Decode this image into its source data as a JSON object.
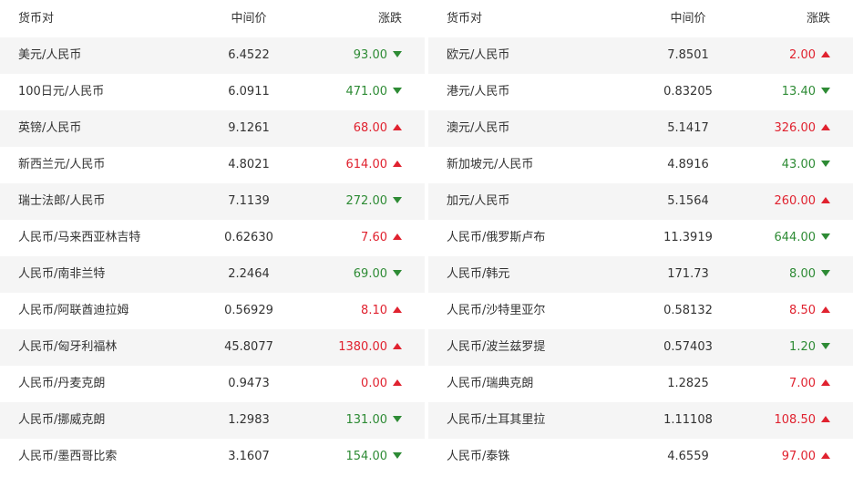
{
  "headers": {
    "pair": "货币对",
    "mid": "中间价",
    "change": "涨跌"
  },
  "colors": {
    "up": "#e0222f",
    "down": "#2e8b35",
    "stripe": "#f5f5f5"
  },
  "left": [
    {
      "pair": "美元/人民币",
      "mid": "6.4522",
      "change": "93.00",
      "dir": "down"
    },
    {
      "pair": "100日元/人民币",
      "mid": "6.0911",
      "change": "471.00",
      "dir": "down"
    },
    {
      "pair": "英镑/人民币",
      "mid": "9.1261",
      "change": "68.00",
      "dir": "up"
    },
    {
      "pair": "新西兰元/人民币",
      "mid": "4.8021",
      "change": "614.00",
      "dir": "up"
    },
    {
      "pair": "瑞士法郎/人民币",
      "mid": "7.1139",
      "change": "272.00",
      "dir": "down"
    },
    {
      "pair": "人民币/马来西亚林吉特",
      "mid": "0.62630",
      "change": "7.60",
      "dir": "up"
    },
    {
      "pair": "人民币/南非兰特",
      "mid": "2.2464",
      "change": "69.00",
      "dir": "down"
    },
    {
      "pair": "人民币/阿联酋迪拉姆",
      "mid": "0.56929",
      "change": "8.10",
      "dir": "up"
    },
    {
      "pair": "人民币/匈牙利福林",
      "mid": "45.8077",
      "change": "1380.00",
      "dir": "up"
    },
    {
      "pair": "人民币/丹麦克朗",
      "mid": "0.9473",
      "change": "0.00",
      "dir": "up"
    },
    {
      "pair": "人民币/挪威克朗",
      "mid": "1.2983",
      "change": "131.00",
      "dir": "down"
    },
    {
      "pair": "人民币/墨西哥比索",
      "mid": "3.1607",
      "change": "154.00",
      "dir": "down"
    }
  ],
  "right": [
    {
      "pair": "欧元/人民币",
      "mid": "7.8501",
      "change": "2.00",
      "dir": "up"
    },
    {
      "pair": "港元/人民币",
      "mid": "0.83205",
      "change": "13.40",
      "dir": "down"
    },
    {
      "pair": "澳元/人民币",
      "mid": "5.1417",
      "change": "326.00",
      "dir": "up"
    },
    {
      "pair": "新加坡元/人民币",
      "mid": "4.8916",
      "change": "43.00",
      "dir": "down"
    },
    {
      "pair": "加元/人民币",
      "mid": "5.1564",
      "change": "260.00",
      "dir": "up"
    },
    {
      "pair": "人民币/俄罗斯卢布",
      "mid": "11.3919",
      "change": "644.00",
      "dir": "down"
    },
    {
      "pair": "人民币/韩元",
      "mid": "171.73",
      "change": "8.00",
      "dir": "down"
    },
    {
      "pair": "人民币/沙特里亚尔",
      "mid": "0.58132",
      "change": "8.50",
      "dir": "up"
    },
    {
      "pair": "人民币/波兰兹罗提",
      "mid": "0.57403",
      "change": "1.20",
      "dir": "down"
    },
    {
      "pair": "人民币/瑞典克朗",
      "mid": "1.2825",
      "change": "7.00",
      "dir": "up"
    },
    {
      "pair": "人民币/土耳其里拉",
      "mid": "1.11108",
      "change": "108.50",
      "dir": "up"
    },
    {
      "pair": "人民币/泰铢",
      "mid": "4.6559",
      "change": "97.00",
      "dir": "up"
    }
  ]
}
